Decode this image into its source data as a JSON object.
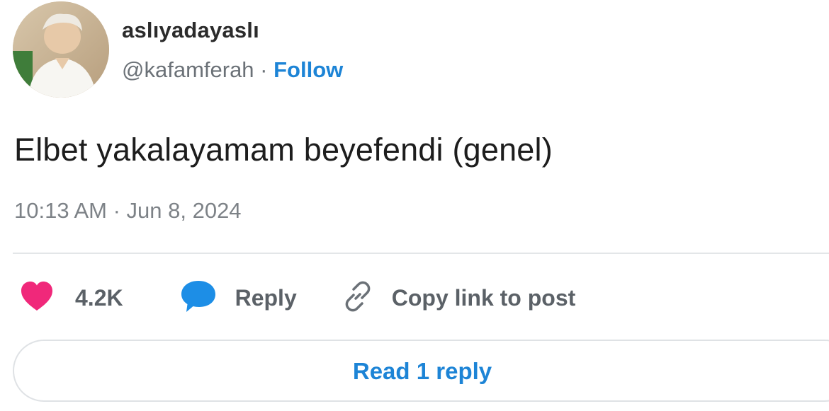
{
  "author": {
    "display_name": "aslıyadayaslı",
    "handle": "@kafamferah",
    "separator": " · ",
    "follow_label": "Follow"
  },
  "tweet": {
    "text": "Elbet yakalayamam beyefendi (genel)",
    "timestamp": "10:13 AM · Jun 8, 2024"
  },
  "actions": {
    "like_count": "4.2K",
    "reply_label": "Reply",
    "copy_link_label": "Copy link to post"
  },
  "read_replies_label": "Read 1 reply",
  "colors": {
    "accent": "#1d84d6",
    "like": "#f0287a",
    "reply_bubble": "#1d8ee6",
    "muted": "#7d8287"
  },
  "icons": {
    "like": "heart-icon",
    "reply": "speech-bubble-icon",
    "copy_link": "link-icon"
  }
}
